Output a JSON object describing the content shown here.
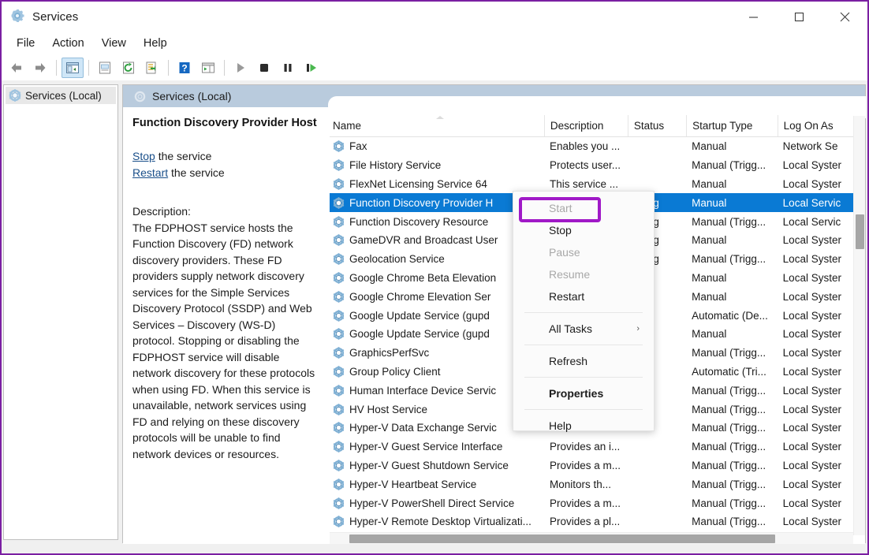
{
  "window": {
    "title": "Services",
    "app_icon": "services-gear-icon",
    "controls": {
      "minimize": "minimize-icon",
      "maximize": "maximize-icon",
      "close": "close-icon"
    }
  },
  "menubar": {
    "items": [
      "File",
      "Action",
      "View",
      "Help"
    ]
  },
  "toolbar": {
    "items": [
      {
        "name": "back-icon",
        "label": "Back"
      },
      {
        "name": "forward-icon",
        "label": "Forward"
      },
      {
        "name": "show-hide-console-tree-icon",
        "label": "Show/Hide Console Tree",
        "active": true
      },
      {
        "name": "properties-icon",
        "label": "Properties"
      },
      {
        "name": "refresh-icon",
        "label": "Refresh"
      },
      {
        "name": "export-list-icon",
        "label": "Export List"
      },
      {
        "name": "help-icon",
        "label": "Help"
      },
      {
        "name": "show-hide-action-pane-icon",
        "label": "Show/Hide Action Pane"
      },
      {
        "name": "start-service-icon",
        "label": "Start Service"
      },
      {
        "name": "stop-service-icon",
        "label": "Stop Service"
      },
      {
        "name": "pause-service-icon",
        "label": "Pause Service"
      },
      {
        "name": "restart-service-icon",
        "label": "Restart Service"
      }
    ]
  },
  "tree": {
    "items": [
      {
        "label": "Services (Local)",
        "icon": "services-gear-icon"
      }
    ]
  },
  "pane": {
    "header": "Services (Local)",
    "header_icon": "services-gear-icon"
  },
  "details": {
    "service_name": "Function Discovery Provider Host",
    "stop_link": "Stop",
    "stop_suffix": " the service",
    "restart_link": "Restart",
    "restart_suffix": " the service",
    "description_label": "Description:",
    "description_text": "The FDPHOST service hosts the Function Discovery (FD) network discovery providers. These FD providers supply network discovery services for the Simple Services Discovery Protocol (SSDP) and Web Services – Discovery (WS-D) protocol. Stopping or disabling the FDPHOST service will disable network discovery for these protocols when using FD. When this service is unavailable, network services using FD and relying on these discovery protocols will be unable to find network devices or resources."
  },
  "table": {
    "columns": [
      "Name",
      "Description",
      "Status",
      "Startup Type",
      "Log On As"
    ],
    "sort_column": "Name",
    "rows": [
      {
        "name": "Fax",
        "description": "Enables you ...",
        "status": "",
        "startup": "Manual",
        "logon": "Network Se",
        "selected": false
      },
      {
        "name": "File History Service",
        "description": "Protects user...",
        "status": "",
        "startup": "Manual (Trigg...",
        "logon": "Local Syster",
        "selected": false
      },
      {
        "name": "FlexNet Licensing Service 64",
        "description": "This service ...",
        "status": "",
        "startup": "Manual",
        "logon": "Local Syster",
        "selected": false
      },
      {
        "name": "Function Discovery Provider H",
        "description": "",
        "status": "nning",
        "startup": "Manual",
        "logon": "Local Servic",
        "selected": true
      },
      {
        "name": "Function Discovery Resource",
        "description": "",
        "status": "nning",
        "startup": "Manual (Trigg...",
        "logon": "Local Servic",
        "selected": false
      },
      {
        "name": "GameDVR and Broadcast User",
        "description": "",
        "status": "nning",
        "startup": "Manual",
        "logon": "Local Syster",
        "selected": false
      },
      {
        "name": "Geolocation Service",
        "description": "",
        "status": "nning",
        "startup": "Manual (Trigg...",
        "logon": "Local Syster",
        "selected": false
      },
      {
        "name": "Google Chrome Beta Elevation",
        "description": "",
        "status": "",
        "startup": "Manual",
        "logon": "Local Syster",
        "selected": false
      },
      {
        "name": "Google Chrome Elevation Ser",
        "description": "",
        "status": "",
        "startup": "Manual",
        "logon": "Local Syster",
        "selected": false
      },
      {
        "name": "Google Update Service (gupd",
        "description": "",
        "status": "",
        "startup": "Automatic (De...",
        "logon": "Local Syster",
        "selected": false
      },
      {
        "name": "Google Update Service (gupd",
        "description": "",
        "status": "",
        "startup": "Manual",
        "logon": "Local Syster",
        "selected": false
      },
      {
        "name": "GraphicsPerfSvc",
        "description": "",
        "status": "",
        "startup": "Manual (Trigg...",
        "logon": "Local Syster",
        "selected": false
      },
      {
        "name": "Group Policy Client",
        "description": "",
        "status": "",
        "startup": "Automatic (Tri...",
        "logon": "Local Syster",
        "selected": false
      },
      {
        "name": "Human Interface Device Servic",
        "description": "",
        "status": "",
        "startup": "Manual (Trigg...",
        "logon": "Local Syster",
        "selected": false
      },
      {
        "name": "HV Host Service",
        "description": "",
        "status": "",
        "startup": "Manual (Trigg...",
        "logon": "Local Syster",
        "selected": false
      },
      {
        "name": "Hyper-V Data Exchange Servic",
        "description": "",
        "status": "",
        "startup": "Manual (Trigg...",
        "logon": "Local Syster",
        "selected": false
      },
      {
        "name": "Hyper-V Guest Service Interface",
        "description": "Provides an i...",
        "status": "",
        "startup": "Manual (Trigg...",
        "logon": "Local Syster",
        "selected": false
      },
      {
        "name": "Hyper-V Guest Shutdown Service",
        "description": "Provides a m...",
        "status": "",
        "startup": "Manual (Trigg...",
        "logon": "Local Syster",
        "selected": false
      },
      {
        "name": "Hyper-V Heartbeat Service",
        "description": "Monitors th...",
        "status": "",
        "startup": "Manual (Trigg...",
        "logon": "Local Syster",
        "selected": false
      },
      {
        "name": "Hyper-V PowerShell Direct Service",
        "description": "Provides a m...",
        "status": "",
        "startup": "Manual (Trigg...",
        "logon": "Local Syster",
        "selected": false
      },
      {
        "name": "Hyper-V Remote Desktop Virtualizati...",
        "description": "Provides a pl...",
        "status": "",
        "startup": "Manual (Trigg...",
        "logon": "Local Syster",
        "selected": false
      }
    ]
  },
  "context_menu": {
    "items": [
      {
        "label": "Start",
        "disabled": true,
        "bold": false,
        "highlighted": true
      },
      {
        "label": "Stop",
        "disabled": false,
        "bold": false
      },
      {
        "label": "Pause",
        "disabled": true,
        "bold": false
      },
      {
        "label": "Resume",
        "disabled": true,
        "bold": false
      },
      {
        "label": "Restart",
        "disabled": false,
        "bold": false
      },
      {
        "separator": true
      },
      {
        "label": "All Tasks",
        "disabled": false,
        "bold": false,
        "submenu": "›"
      },
      {
        "separator": true
      },
      {
        "label": "Refresh",
        "disabled": false,
        "bold": false
      },
      {
        "separator": true
      },
      {
        "label": "Properties",
        "disabled": false,
        "bold": true
      },
      {
        "separator": true
      },
      {
        "label": "Help",
        "disabled": false,
        "bold": false
      }
    ],
    "highlight_color": "#a019c7"
  },
  "colors": {
    "selection_blue": "#0a7ad4",
    "pane_header": "#b9cbdd",
    "link": "#1a4f8a",
    "window_border": "#7a1fa2"
  }
}
